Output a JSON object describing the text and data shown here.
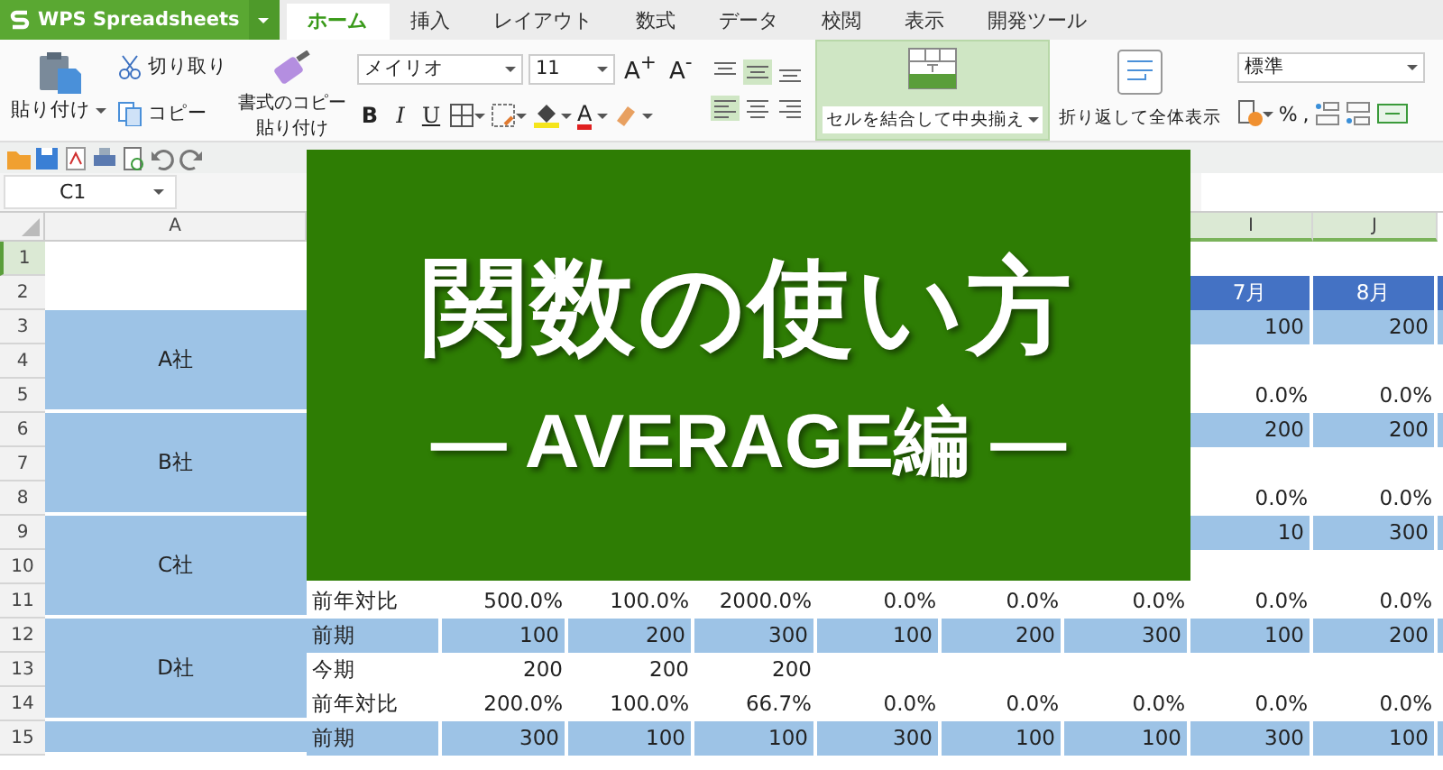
{
  "app": {
    "brand": "WPS Spreadsheets"
  },
  "tabs": [
    {
      "label": "ホーム",
      "selected": true
    },
    {
      "label": "挿入",
      "selected": false
    },
    {
      "label": "レイアウト",
      "selected": false
    },
    {
      "label": "数式",
      "selected": false
    },
    {
      "label": "データ",
      "selected": false
    },
    {
      "label": "校閲",
      "selected": false
    },
    {
      "label": "表示",
      "selected": false
    },
    {
      "label": "開発ツール",
      "selected": false
    }
  ],
  "ribbon": {
    "paste": "貼り付け",
    "cut": "切り取り",
    "copy": "コピー",
    "format_painter": [
      "書式のコピー",
      "貼り付け"
    ],
    "font": "メイリオ",
    "font_size": "11",
    "size_buttons": [
      "A$^{+}$",
      "A$^{-}$"
    ],
    "format_buttons": [
      "B",
      "I",
      "U"
    ],
    "font_color": "A",
    "align_buttons": [
      {
        "selected": false
      },
      {
        "selected": true
      },
      {
        "selected": false
      },
      {
        "selected": true
      },
      {
        "selected": false
      },
      {
        "selected": false
      }
    ],
    "merge": {
      "label": "セルを結合して中央揃え",
      "selected": true
    },
    "wrap": "折り返して全体表示",
    "number_format": "標準",
    "number_symbols": [
      "%",
      ","
    ]
  },
  "formula_bar": {
    "cell": "C1"
  },
  "banner": {
    "title": "関数の使い方",
    "subtitle": "— AVERAGE編 —"
  },
  "sheet": {
    "columns": [
      {
        "label": "A",
        "selected": false
      },
      null,
      null,
      null,
      null,
      null,
      null,
      null,
      {
        "label": "I",
        "selected": true
      },
      {
        "label": "J",
        "selected": true
      }
    ],
    "header_rows": [
      {
        "number": "1",
        "selected": true,
        "kind": "title",
        "cells": [
          null,
          null,
          null,
          null,
          null,
          null,
          null,
          null,
          null
        ]
      },
      {
        "number": "2",
        "selected": false,
        "kind": "months",
        "cells": [
          null,
          null,
          null,
          null,
          null,
          null,
          null,
          "7月",
          "8月"
        ]
      }
    ],
    "blocks": [
      {
        "company": "A社",
        "rows": [
          {
            "number": "3",
            "selected": false,
            "kind": "prev",
            "cells": [
              null,
              null,
              null,
              null,
              null,
              null,
              null,
              "100",
              "200"
            ]
          },
          {
            "number": "4",
            "selected": false,
            "kind": "current",
            "cells": [
              null,
              null,
              null,
              null,
              null,
              null,
              null,
              null,
              null
            ]
          },
          {
            "number": "5",
            "selected": false,
            "kind": "ratio",
            "cells": [
              null,
              null,
              null,
              null,
              null,
              null,
              null,
              "0.0%",
              "0.0%"
            ]
          }
        ]
      },
      {
        "company": "B社",
        "rows": [
          {
            "number": "6",
            "selected": false,
            "kind": "prev",
            "cells": [
              null,
              null,
              null,
              null,
              null,
              null,
              null,
              "200",
              "200"
            ]
          },
          {
            "number": "7",
            "selected": false,
            "kind": "current",
            "cells": [
              null,
              null,
              null,
              null,
              null,
              null,
              null,
              null,
              null
            ]
          },
          {
            "number": "8",
            "selected": false,
            "kind": "ratio",
            "cells": [
              null,
              null,
              null,
              null,
              null,
              null,
              null,
              "0.0%",
              "0.0%"
            ]
          }
        ]
      },
      {
        "company": "C社",
        "rows": [
          {
            "number": "9",
            "selected": false,
            "kind": "prev",
            "cells": [
              null,
              null,
              null,
              null,
              null,
              null,
              null,
              "10",
              "300"
            ]
          },
          {
            "number": "10",
            "selected": false,
            "kind": "current",
            "cells": [
              null,
              null,
              null,
              null,
              null,
              null,
              null,
              null,
              null
            ]
          },
          {
            "number": "11",
            "selected": false,
            "kind": "ratio",
            "cells": [
              "前年対比",
              "500.0%",
              "100.0%",
              "2000.0%",
              "0.0%",
              "0.0%",
              "0.0%",
              "0.0%",
              "0.0%"
            ]
          }
        ]
      },
      {
        "company": "D社",
        "rows": [
          {
            "number": "12",
            "selected": false,
            "kind": "prev",
            "cells": [
              "前期",
              "100",
              "200",
              "300",
              "100",
              "200",
              "300",
              "100",
              "200"
            ]
          },
          {
            "number": "13",
            "selected": false,
            "kind": "current",
            "cells": [
              "今期",
              "200",
              "200",
              "200",
              null,
              null,
              null,
              null,
              null
            ]
          },
          {
            "number": "14",
            "selected": false,
            "kind": "ratio",
            "cells": [
              "前年対比",
              "200.0%",
              "100.0%",
              "66.7%",
              "0.0%",
              "0.0%",
              "0.0%",
              "0.0%",
              "0.0%"
            ]
          }
        ]
      },
      {
        "rows": [
          {
            "number": "15",
            "selected": false,
            "kind": "prev",
            "cells": [
              "前期",
              "300",
              "100",
              "100",
              "300",
              "100",
              "100",
              "300",
              "100"
            ]
          }
        ]
      }
    ]
  }
}
